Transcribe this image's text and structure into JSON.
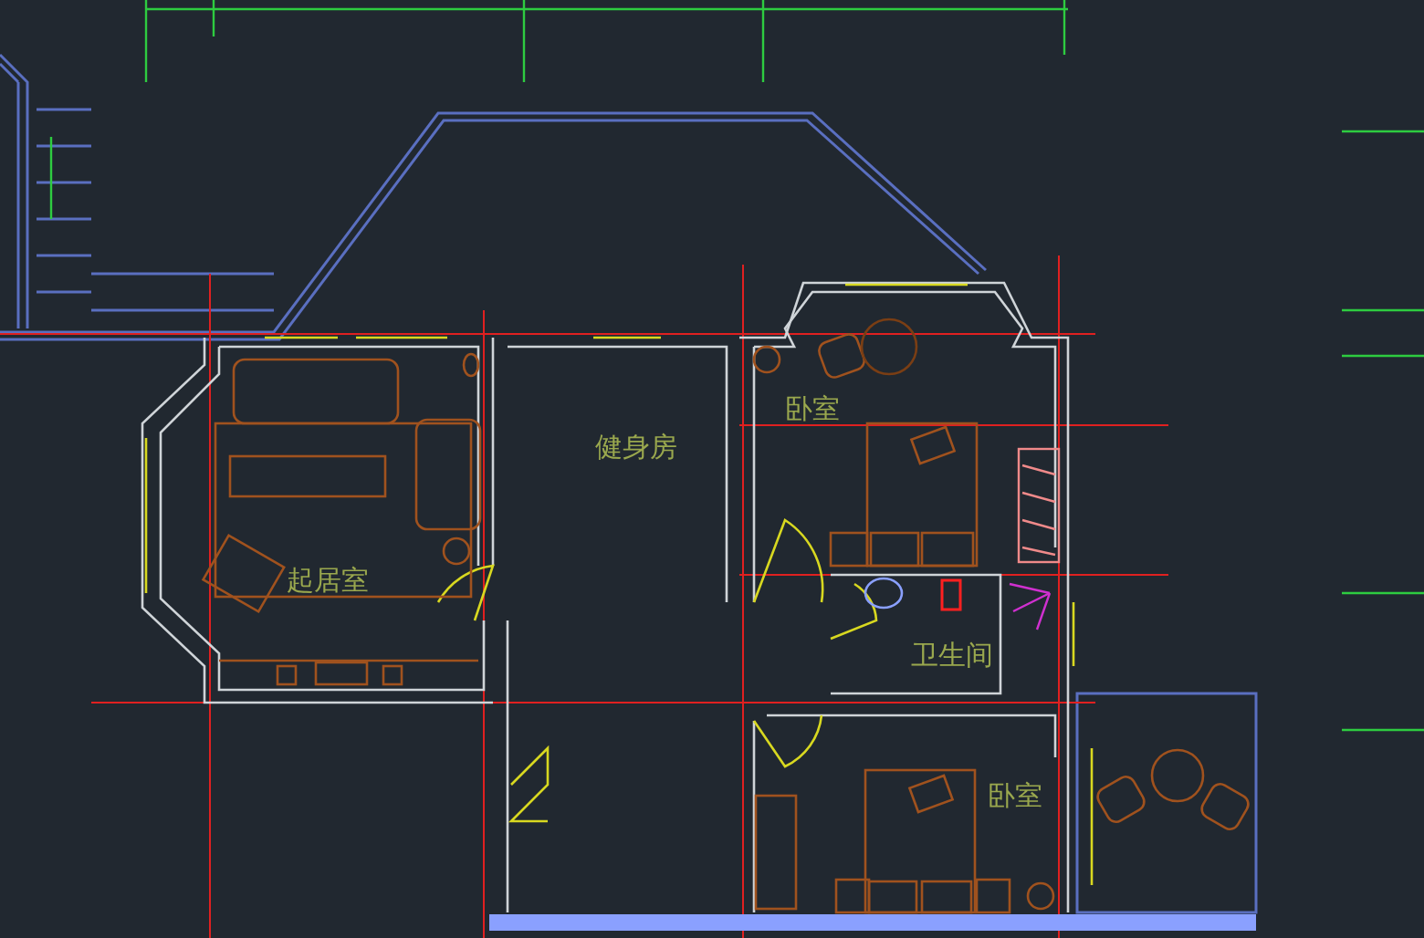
{
  "floor_plan": {
    "rooms": [
      {
        "label": "起居室"
      },
      {
        "label": "健身房"
      },
      {
        "label": "卧室"
      },
      {
        "label": "卫生间"
      },
      {
        "label": "卧室"
      }
    ]
  }
}
